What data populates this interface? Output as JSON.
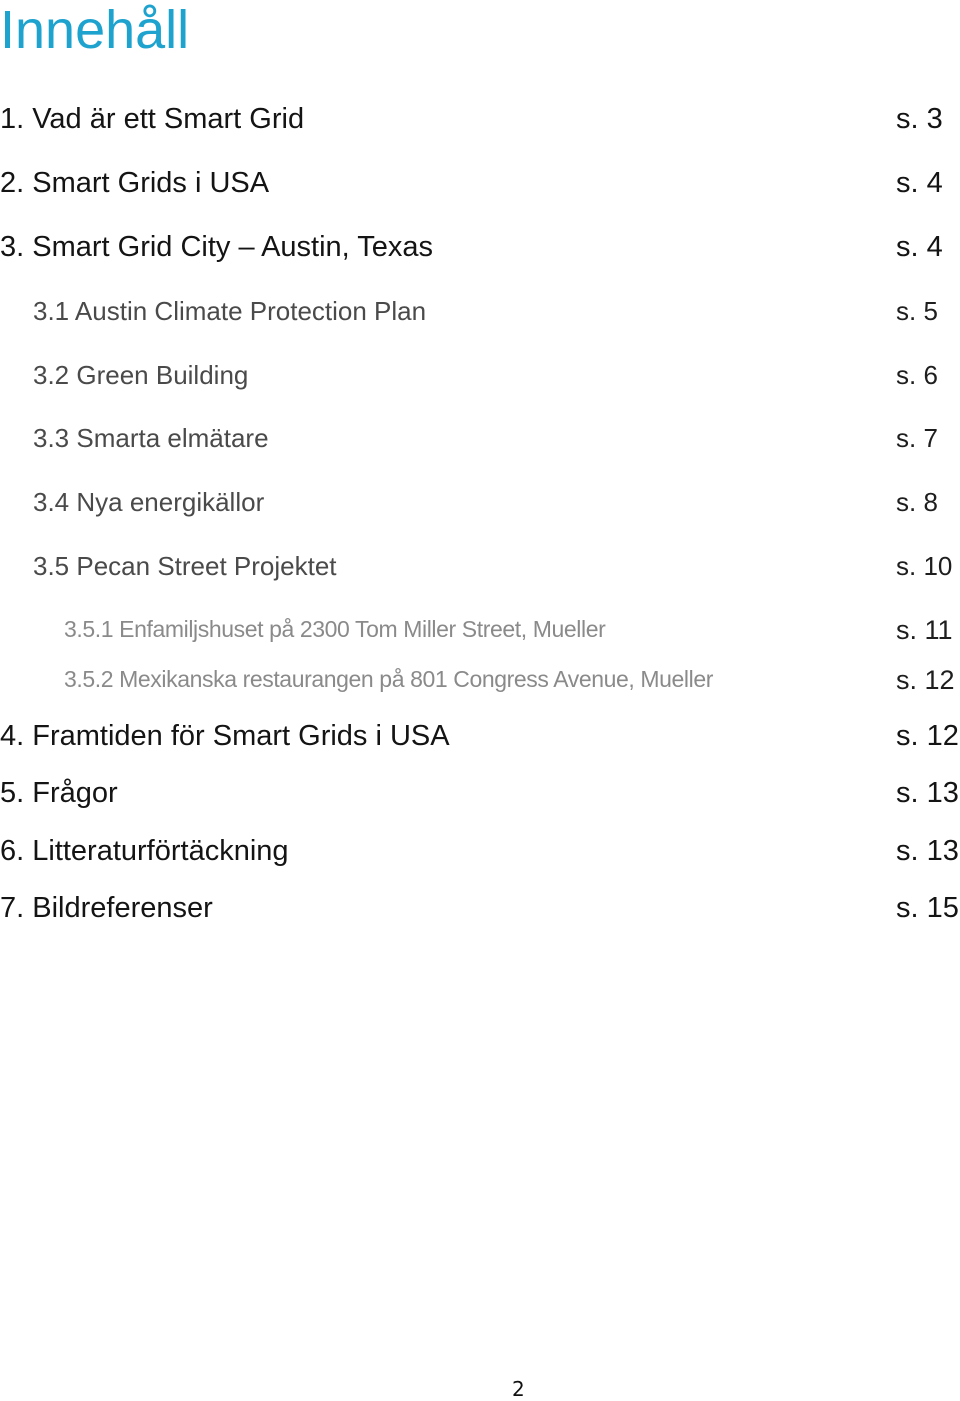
{
  "document": {
    "title": "Innehåll",
    "title_color": "#1ea3cf",
    "page_number": "2"
  },
  "toc": [
    {
      "level": 1,
      "label": "1. Vad är ett Smart Grid",
      "page": "s. 3"
    },
    {
      "level": 1,
      "label": "2. Smart Grids i USA",
      "page": "s. 4"
    },
    {
      "level": 1,
      "label": "3. Smart Grid City – Austin, Texas",
      "page": "s. 4"
    },
    {
      "level": 2,
      "label": "3.1 Austin Climate Protection Plan",
      "page": "s. 5"
    },
    {
      "level": 2,
      "label": "3.2 Green Building",
      "page": "s. 6"
    },
    {
      "level": 2,
      "label": "3.3 Smarta elmätare",
      "page": "s. 7"
    },
    {
      "level": 2,
      "label": "3.4 Nya energikällor",
      "page": "s. 8"
    },
    {
      "level": 2,
      "label": "3.5 Pecan Street Projektet",
      "page": "s. 10"
    },
    {
      "level": 3,
      "label": "3.5.1 Enfamiljshuset på 2300 Tom Miller Street, Mueller",
      "page": "s. 11"
    },
    {
      "level": 3,
      "label": "3.5.2 Mexikanska restaurangen på 801 Congress Avenue, Mueller",
      "page": "s. 12"
    },
    {
      "level": 1,
      "label": "4. Framtiden för Smart Grids i USA",
      "page": "s. 12"
    },
    {
      "level": 1,
      "label": "5. Frågor",
      "page": "s. 13"
    },
    {
      "level": 1,
      "label": "6. Litteraturförtäckning",
      "page": "s. 13"
    },
    {
      "level": 1,
      "label": "7. Bildreferenser",
      "page": "s. 15"
    }
  ]
}
